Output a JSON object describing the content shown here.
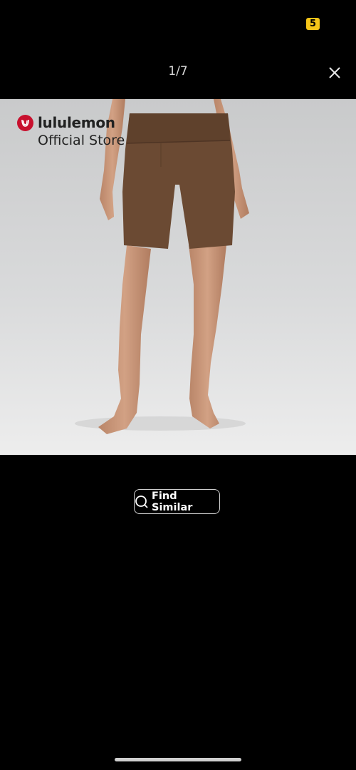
{
  "status": {
    "badge": "5",
    "badge_color": "#f5c518"
  },
  "viewer": {
    "counter": "1/7",
    "close_icon": "close-icon"
  },
  "product_image": {
    "brand_name": "lululemon",
    "brand_sub": "Official Store",
    "brand_color": "#c8102e",
    "garment_color": "#6b4a33"
  },
  "actions": {
    "find_similar_label": "Find Similar",
    "find_similar_icon": "search-icon"
  }
}
